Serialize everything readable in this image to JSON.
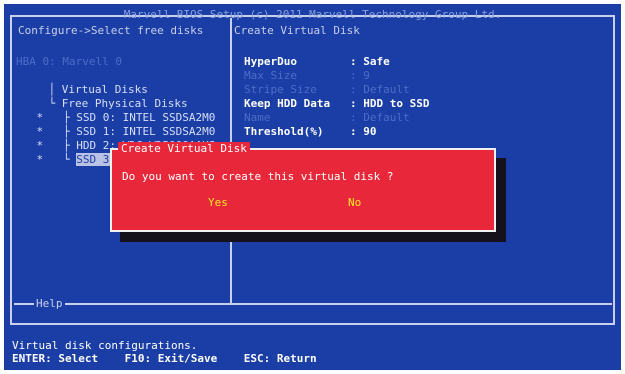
{
  "header": {
    "title": "Marvell BIOS Setup (c) 2011 Marvell Technology Group Ltd.",
    "breadcrumb": "Configure->Select free disks",
    "right_title": "Create Virtual Disk"
  },
  "tree": {
    "root": "HBA 0: Marvell 0",
    "virtual_disks": "Virtual Disks",
    "free_physical_disks": "Free Physical Disks",
    "disks": [
      {
        "marker": "*",
        "label": "SSD 0: INTEL SSDSA2M0"
      },
      {
        "marker": "*",
        "label": "SSD 1: INTEL SSDSA2M0"
      },
      {
        "marker": "*",
        "label": "HDD 2: WDC WD5000AAKS"
      },
      {
        "marker": "*",
        "label": "SSD 3:"
      }
    ]
  },
  "properties": [
    {
      "key": "HyperDuo",
      "value": ": Safe",
      "active": true
    },
    {
      "key": "Max Size",
      "value": ": 9",
      "active": false
    },
    {
      "key": "Stripe Size",
      "value": ": Default",
      "active": false
    },
    {
      "key": "Keep HDD Data",
      "value": ": HDD to SSD",
      "active": true
    },
    {
      "key": "Name",
      "value": ": Default",
      "active": false
    },
    {
      "key": "Threshold(%)",
      "value": ": 90",
      "active": true
    }
  ],
  "dialog": {
    "title": "Create Virtual Disk",
    "message": "Do you want to create this virtual disk ?",
    "yes_label": "Yes",
    "no_label": "No"
  },
  "help": {
    "label": "Help",
    "text": "Virtual disk configurations.",
    "keys": "ENTER: Select    F10: Exit/Save    ESC: Return"
  },
  "colors": {
    "background": "#1b3ea6",
    "dialog": "#e8283a",
    "button_text": "#ffe82a"
  }
}
